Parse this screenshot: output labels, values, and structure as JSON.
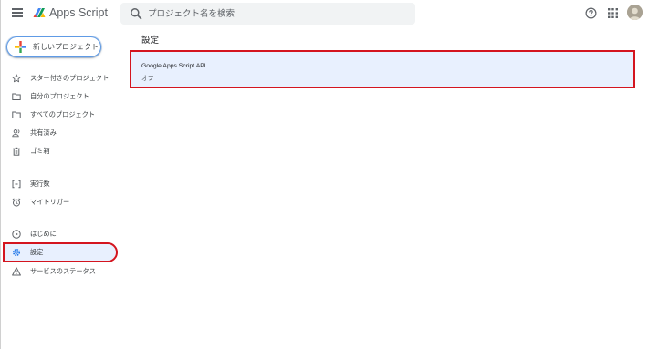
{
  "header": {
    "app_title": "Apps Script",
    "search_placeholder": "プロジェクト名を検索"
  },
  "sidebar": {
    "new_project_label": "新しいプロジェクト",
    "groups": [
      {
        "items": [
          {
            "label": "スター付きのプロジェクト",
            "icon": "star-icon"
          },
          {
            "label": "自分のプロジェクト",
            "icon": "folder-icon"
          },
          {
            "label": "すべてのプロジェクト",
            "icon": "folder-icon"
          },
          {
            "label": "共有済み",
            "icon": "people-icon"
          },
          {
            "label": "ゴミ箱",
            "icon": "trash-icon"
          }
        ]
      },
      {
        "items": [
          {
            "label": "実行数",
            "icon": "executions-icon"
          },
          {
            "label": "マイトリガー",
            "icon": "alarm-icon"
          }
        ]
      },
      {
        "items": [
          {
            "label": "はじめに",
            "icon": "play-circle-icon"
          },
          {
            "label": "設定",
            "icon": "gear-icon",
            "active": true
          },
          {
            "label": "サービスのステータス",
            "icon": "warning-icon"
          }
        ]
      }
    ]
  },
  "main": {
    "title": "設定",
    "settings": [
      {
        "name": "Google Apps Script API",
        "value": "オフ"
      }
    ]
  },
  "colors": {
    "accent_blue": "#1a73e8",
    "active_bg": "#e8f0fe",
    "highlight_red": "#d4151f"
  }
}
